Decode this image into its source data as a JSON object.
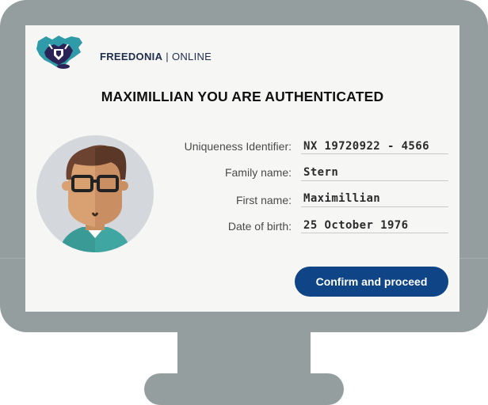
{
  "brand": {
    "name": "FREEDONIA",
    "separator": "|",
    "suffix": "ONLINE",
    "logo_icon": "freedonia-map-shield-icon",
    "colors": {
      "dark": "#2a2356",
      "teal": "#2f9aa8"
    }
  },
  "title": "MAXIMILLIAN YOU ARE AUTHENTICATED",
  "avatar": {
    "icon": "user-avatar-glasses-icon"
  },
  "fields": [
    {
      "label": "Uniqueness Identifier:",
      "value": "NX 19720922 - 4566"
    },
    {
      "label": "Family name:",
      "value": "Stern"
    },
    {
      "label": "First name:",
      "value": "Maximillian"
    },
    {
      "label": "Date of birth:",
      "value": "25 October 1976"
    }
  ],
  "confirm_button": {
    "label": "Confirm and proceed",
    "color": "#0f4587"
  },
  "colors": {
    "monitor": "#949e9e",
    "screen": "#f6f6f4"
  }
}
